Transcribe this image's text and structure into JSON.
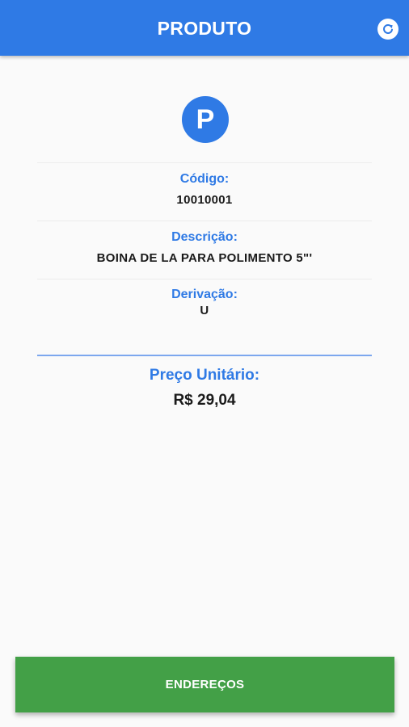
{
  "header": {
    "title": "PRODUTO",
    "refresh_icon": "refresh-icon"
  },
  "product": {
    "badge_letter": "P",
    "code_label": "Código:",
    "code_value": "10010001",
    "description_label": "Descrição:",
    "description_value": "BOINA DE LA PARA POLIMENTO 5\"'",
    "derivation_label": "Derivação:",
    "derivation_value": "U",
    "price_label": "Preço Unitário:",
    "price_value": "R$ 29,04"
  },
  "footer": {
    "button_label": "ENDEREÇOS"
  },
  "colors": {
    "primary": "#2f7ae5",
    "accent_green": "#43a047",
    "background": "#fafafa"
  }
}
